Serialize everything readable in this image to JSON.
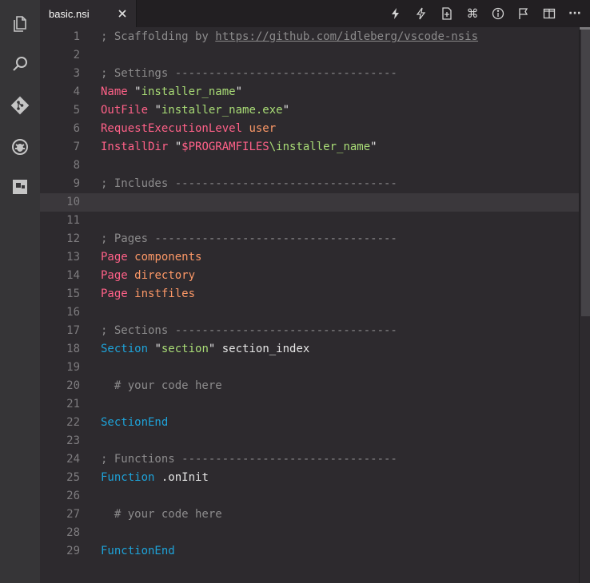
{
  "tab": {
    "title": "basic.nsi",
    "close_glyph": "×"
  },
  "activity_icons": [
    "files-icon",
    "search-icon",
    "git-icon",
    "debug-icon",
    "extensions-icon"
  ],
  "toolbar_icons": [
    "lightning-icon",
    "lightning-outline-icon",
    "file-add-icon",
    "command-icon",
    "info-icon",
    "flag-icon",
    "split-editor-icon",
    "more-icon"
  ],
  "toolbar_glyphs": {
    "command": "⌘",
    "more": "···"
  },
  "colors": {
    "comment": "#8c8b8c",
    "keyword": "#ff6188",
    "string": "#a9dc76",
    "constant": "#fc9867",
    "section": "#1ea3d9",
    "background": "#2d2a2e"
  },
  "editor": {
    "current_line": 10,
    "lines": [
      {
        "n": "1",
        "t": [
          [
            "comment",
            "; Scaffolding by "
          ],
          [
            "url",
            "https://github.com/idleberg/vscode-nsis"
          ]
        ]
      },
      {
        "n": "2",
        "t": []
      },
      {
        "n": "3",
        "t": [
          [
            "comment",
            "; Settings ---------------------------------"
          ]
        ]
      },
      {
        "n": "4",
        "t": [
          [
            "kw",
            "Name"
          ],
          [
            "plain",
            " \""
          ],
          [
            "str",
            "installer_name"
          ],
          [
            "plain",
            "\""
          ]
        ]
      },
      {
        "n": "5",
        "t": [
          [
            "kw",
            "OutFile"
          ],
          [
            "plain",
            " \""
          ],
          [
            "str",
            "installer_name.exe"
          ],
          [
            "plain",
            "\""
          ]
        ]
      },
      {
        "n": "6",
        "t": [
          [
            "kw",
            "RequestExecutionLevel"
          ],
          [
            "plain",
            " "
          ],
          [
            "const",
            "user"
          ]
        ]
      },
      {
        "n": "7",
        "t": [
          [
            "kw",
            "InstallDir"
          ],
          [
            "plain",
            " \""
          ],
          [
            "var",
            "$PROGRAMFILES"
          ],
          [
            "str",
            "\\installer_name"
          ],
          [
            "plain",
            "\""
          ]
        ]
      },
      {
        "n": "8",
        "t": []
      },
      {
        "n": "9",
        "t": [
          [
            "comment",
            "; Includes ---------------------------------"
          ]
        ]
      },
      {
        "n": "10",
        "t": []
      },
      {
        "n": "11",
        "t": []
      },
      {
        "n": "12",
        "t": [
          [
            "comment",
            "; Pages ------------------------------------"
          ]
        ]
      },
      {
        "n": "13",
        "t": [
          [
            "kw",
            "Page"
          ],
          [
            "plain",
            " "
          ],
          [
            "const",
            "components"
          ]
        ]
      },
      {
        "n": "14",
        "t": [
          [
            "kw",
            "Page"
          ],
          [
            "plain",
            " "
          ],
          [
            "const",
            "directory"
          ]
        ]
      },
      {
        "n": "15",
        "t": [
          [
            "kw",
            "Page"
          ],
          [
            "plain",
            " "
          ],
          [
            "const",
            "instfiles"
          ]
        ]
      },
      {
        "n": "16",
        "t": []
      },
      {
        "n": "17",
        "t": [
          [
            "comment",
            "; Sections ---------------------------------"
          ]
        ]
      },
      {
        "n": "18",
        "t": [
          [
            "blue",
            "Section"
          ],
          [
            "plain",
            " \""
          ],
          [
            "str",
            "section"
          ],
          [
            "plain",
            "\" section_index"
          ]
        ]
      },
      {
        "n": "19",
        "t": []
      },
      {
        "n": "20",
        "t": [
          [
            "comment",
            "  # your code here"
          ]
        ]
      },
      {
        "n": "21",
        "t": []
      },
      {
        "n": "22",
        "t": [
          [
            "blue",
            "SectionEnd"
          ]
        ]
      },
      {
        "n": "23",
        "t": []
      },
      {
        "n": "24",
        "t": [
          [
            "comment",
            "; Functions --------------------------------"
          ]
        ]
      },
      {
        "n": "25",
        "t": [
          [
            "blue",
            "Function"
          ],
          [
            "plain",
            " .onInit"
          ]
        ]
      },
      {
        "n": "26",
        "t": []
      },
      {
        "n": "27",
        "t": [
          [
            "comment",
            "  # your code here"
          ]
        ]
      },
      {
        "n": "28",
        "t": []
      },
      {
        "n": "29",
        "t": [
          [
            "blue",
            "FunctionEnd"
          ]
        ]
      }
    ]
  }
}
